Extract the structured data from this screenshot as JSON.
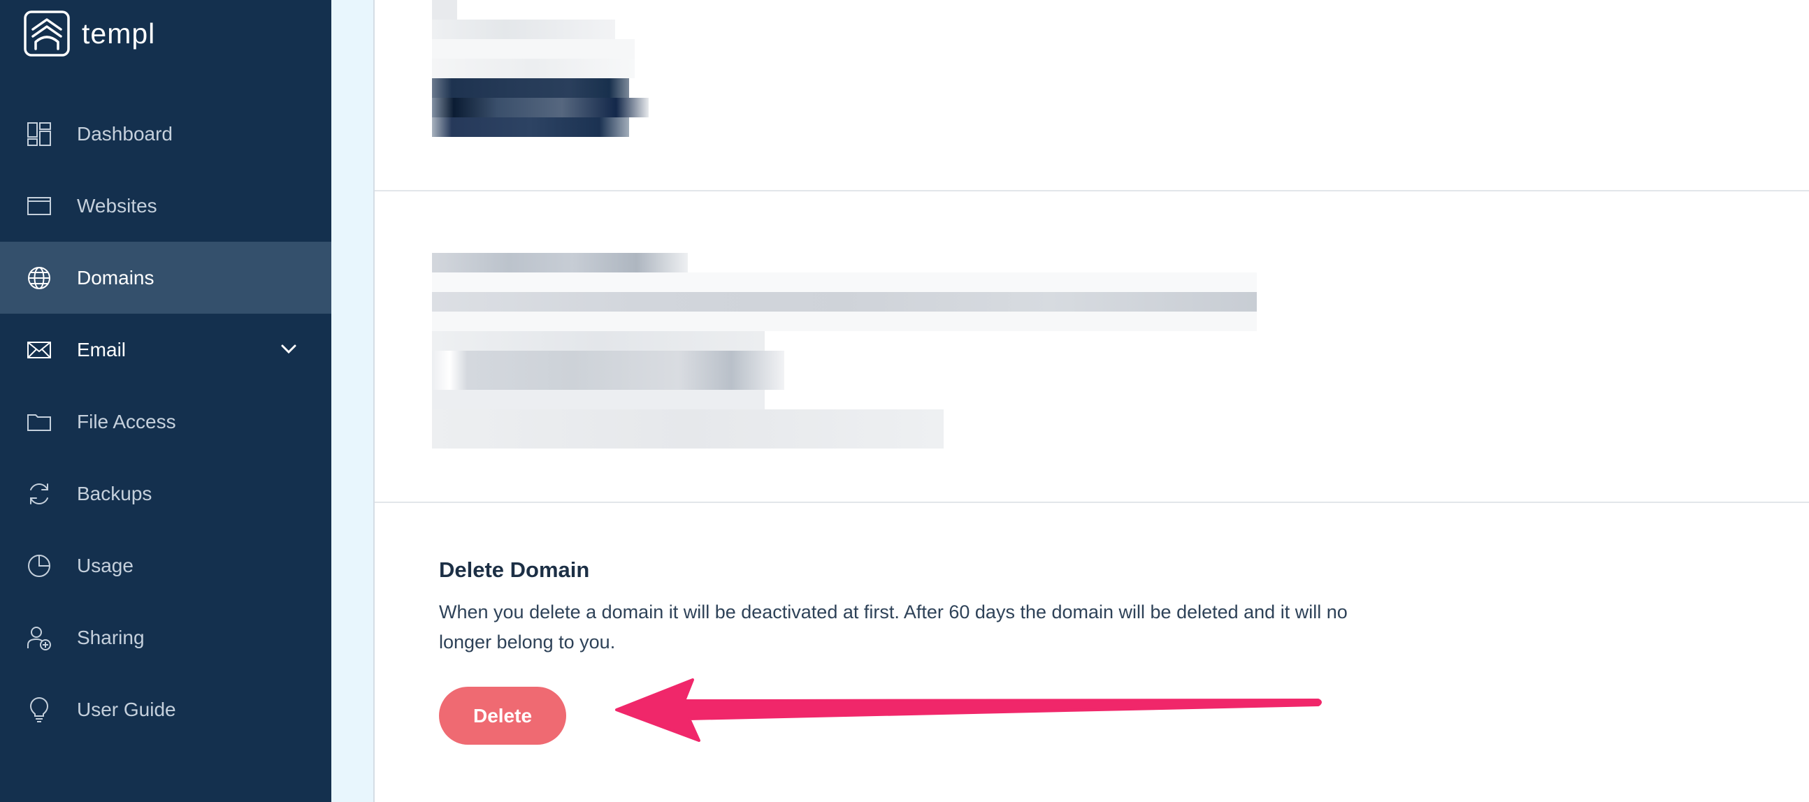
{
  "app": {
    "name": "templ"
  },
  "sidebar": {
    "items": [
      {
        "label": "Dashboard",
        "icon": "dashboard-icon"
      },
      {
        "label": "Websites",
        "icon": "browser-window-icon"
      },
      {
        "label": "Domains",
        "icon": "globe-icon",
        "active": true
      },
      {
        "label": "Email",
        "icon": "envelope-icon",
        "expandable": true
      },
      {
        "label": "File Access",
        "icon": "folder-icon"
      },
      {
        "label": "Backups",
        "icon": "refresh-icon"
      },
      {
        "label": "Usage",
        "icon": "pie-chart-icon"
      },
      {
        "label": "Sharing",
        "icon": "user-add-icon"
      },
      {
        "label": "User Guide",
        "icon": "lightbulb-icon"
      }
    ]
  },
  "delete_section": {
    "title": "Delete Domain",
    "description": "When you delete a domain it will be deactivated at first. After 60 days the domain will be deleted and it will no longer belong to you.",
    "button_label": "Delete"
  },
  "colors": {
    "sidebar_bg": "#14304e",
    "sidebar_active": "#34506c",
    "delete_button": "#ef6a72",
    "annotation_arrow": "#f0276a"
  }
}
